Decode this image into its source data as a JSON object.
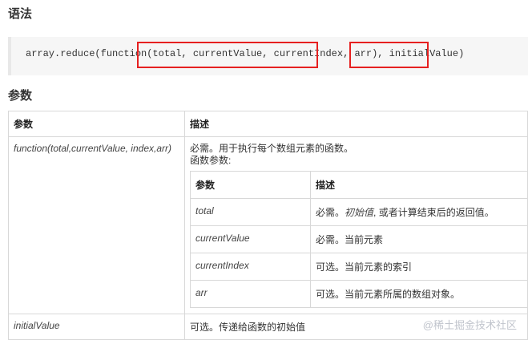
{
  "syntax_heading": "语法",
  "code": "array.reduce(function(total, currentValue, currentIndex, arr), initialValue)",
  "params_heading": "参数",
  "table": {
    "headers": [
      "参数",
      "描述"
    ],
    "rows": [
      {
        "param": "function(total,currentValue, index,arr)",
        "desc_line1": "必需。用于执行每个数组元素的函数。",
        "desc_line2": "函数参数:",
        "inner_headers": [
          "参数",
          "描述"
        ],
        "inner_rows": [
          {
            "param": "total",
            "desc_prefix": "必需。",
            "desc_italic": "初始值",
            "desc_suffix": ", 或者计算结束后的返回值。"
          },
          {
            "param": "currentValue",
            "desc_prefix": "必需。当前元素",
            "desc_italic": "",
            "desc_suffix": ""
          },
          {
            "param": "currentIndex",
            "desc_prefix": "可选。当前元素的索引",
            "desc_italic": "",
            "desc_suffix": ""
          },
          {
            "param": "arr",
            "desc_prefix": "可选。当前元素所属的数组对象。",
            "desc_italic": "",
            "desc_suffix": ""
          }
        ]
      },
      {
        "param": "initialValue",
        "desc_line1": "可选。传递给函数的初始值"
      }
    ]
  },
  "watermark": "@稀土掘金技术社区",
  "colors": {
    "highlight": "#e62020",
    "code_bg": "#f6f6f6",
    "border": "#d8d8d8"
  }
}
